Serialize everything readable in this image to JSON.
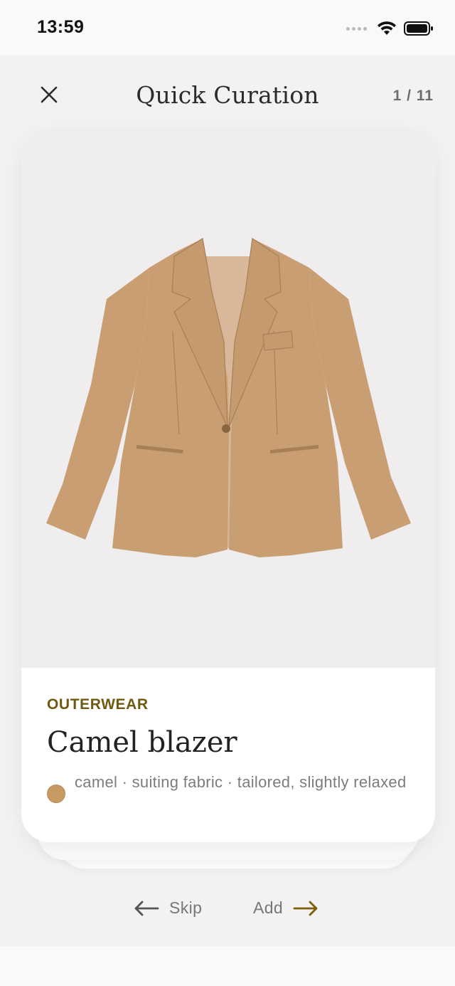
{
  "status_bar": {
    "time": "13:59",
    "icons": [
      "cellular-dots-icon",
      "wifi-icon",
      "battery-icon"
    ]
  },
  "header": {
    "close_icon": "close-icon",
    "title": "Quick Curation",
    "counter": "1 / 11"
  },
  "card": {
    "image": {
      "subject": "camel blazer image",
      "colors": {
        "background": "#efedee",
        "garment": "#c89e72",
        "lining": "#d9b899"
      }
    },
    "category": "OUTERWEAR",
    "title": "Camel blazer",
    "swatch_color": "#c89a63",
    "attributes": "camel · suiting fabric · tailored, slightly relaxed"
  },
  "actions": {
    "skip_label": "Skip",
    "skip_icon": "arrow-left-icon",
    "add_label": "Add",
    "add_icon": "arrow-right-icon",
    "accent_color": "#7a600d"
  }
}
